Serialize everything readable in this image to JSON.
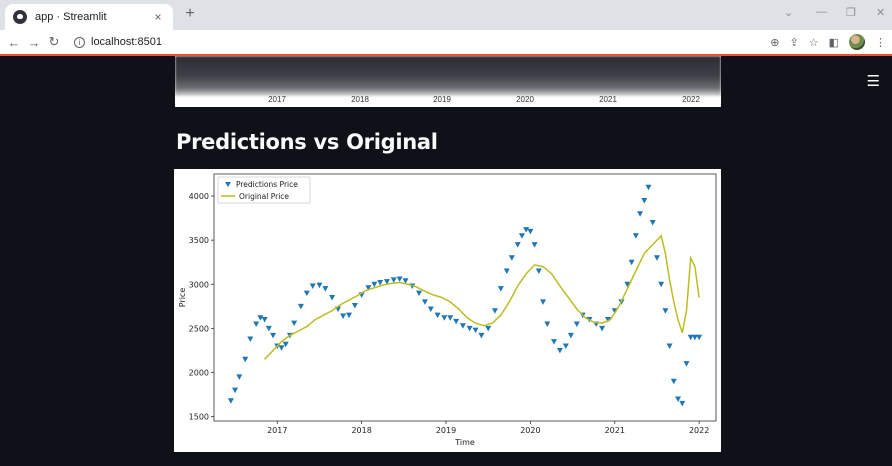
{
  "browser": {
    "tab_title": "app · Streamlit",
    "tab_close": "×",
    "new_tab": "+",
    "url": "localhost:8501",
    "win_minimize": "—",
    "win_restore": "❐",
    "win_close": "✕",
    "chevron": "⌄"
  },
  "app": {
    "menu_icon": "hamburger-menu-icon",
    "previous_chart_xticks": [
      "2017",
      "2018",
      "2019",
      "2020",
      "2021",
      "2022"
    ],
    "heading": "Predictions vs Original"
  },
  "chart_data": {
    "type": "line",
    "title": "",
    "xlabel": "Time",
    "ylabel": "Price",
    "xlim": [
      2016.25,
      2022.2
    ],
    "ylim": [
      1450,
      4250
    ],
    "xticks": [
      2017,
      2018,
      2019,
      2020,
      2021,
      2022
    ],
    "yticks": [
      1500,
      2000,
      2500,
      3000,
      3500,
      4000
    ],
    "legend_position": "top-left",
    "series": [
      {
        "name": "Predictions Price",
        "style": "triangle-down markers",
        "color": "#1f77b4",
        "x": [
          2016.45,
          2016.5,
          2016.55,
          2016.62,
          2016.68,
          2016.75,
          2016.8,
          2016.85,
          2016.9,
          2016.95,
          2017.0,
          2017.05,
          2017.1,
          2017.15,
          2017.2,
          2017.28,
          2017.35,
          2017.42,
          2017.5,
          2017.57,
          2017.65,
          2017.72,
          2017.78,
          2017.85,
          2017.92,
          2018.0,
          2018.08,
          2018.15,
          2018.22,
          2018.3,
          2018.38,
          2018.45,
          2018.52,
          2018.6,
          2018.68,
          2018.75,
          2018.82,
          2018.9,
          2018.98,
          2019.05,
          2019.12,
          2019.2,
          2019.28,
          2019.35,
          2019.42,
          2019.5,
          2019.58,
          2019.65,
          2019.72,
          2019.78,
          2019.85,
          2019.9,
          2019.95,
          2020.0,
          2020.05,
          2020.1,
          2020.15,
          2020.2,
          2020.28,
          2020.35,
          2020.42,
          2020.48,
          2020.55,
          2020.62,
          2020.7,
          2020.78,
          2020.85,
          2020.92,
          2021.0,
          2021.08,
          2021.15,
          2021.2,
          2021.25,
          2021.3,
          2021.35,
          2021.4,
          2021.45,
          2021.5,
          2021.55,
          2021.6,
          2021.65,
          2021.7,
          2021.75,
          2021.8,
          2021.85,
          2021.9,
          2021.95,
          2022.0
        ],
        "y": [
          1680,
          1800,
          1950,
          2150,
          2380,
          2550,
          2620,
          2600,
          2500,
          2420,
          2300,
          2280,
          2320,
          2420,
          2560,
          2750,
          2900,
          2980,
          2990,
          2950,
          2850,
          2720,
          2640,
          2650,
          2760,
          2880,
          2960,
          3000,
          3020,
          3030,
          3050,
          3060,
          3040,
          2980,
          2900,
          2800,
          2720,
          2650,
          2620,
          2620,
          2580,
          2530,
          2500,
          2480,
          2420,
          2500,
          2700,
          2950,
          3150,
          3300,
          3450,
          3550,
          3620,
          3600,
          3450,
          3150,
          2800,
          2550,
          2350,
          2250,
          2300,
          2420,
          2550,
          2650,
          2600,
          2550,
          2500,
          2600,
          2700,
          2800,
          3000,
          3250,
          3550,
          3800,
          3950,
          4100,
          3700,
          3300,
          3000,
          2700,
          2300,
          1900,
          1700,
          1650,
          2100,
          2400,
          2400,
          2400
        ]
      },
      {
        "name": "Original Price",
        "style": "line",
        "color": "#bcbd22",
        "x": [
          2016.85,
          2016.95,
          2017.05,
          2017.15,
          2017.25,
          2017.35,
          2017.45,
          2017.55,
          2017.65,
          2017.75,
          2017.85,
          2017.95,
          2018.05,
          2018.15,
          2018.25,
          2018.35,
          2018.45,
          2018.55,
          2018.65,
          2018.75,
          2018.85,
          2018.95,
          2019.05,
          2019.15,
          2019.25,
          2019.35,
          2019.45,
          2019.55,
          2019.65,
          2019.75,
          2019.85,
          2019.95,
          2020.05,
          2020.15,
          2020.25,
          2020.35,
          2020.45,
          2020.55,
          2020.65,
          2020.75,
          2020.85,
          2020.95,
          2021.05,
          2021.15,
          2021.25,
          2021.35,
          2021.45,
          2021.55,
          2021.6,
          2021.65,
          2021.7,
          2021.75,
          2021.8,
          2021.85,
          2021.9,
          2021.95,
          2022.0
        ],
        "y": [
          2150,
          2250,
          2350,
          2420,
          2470,
          2520,
          2600,
          2650,
          2700,
          2770,
          2820,
          2870,
          2930,
          2960,
          2990,
          3010,
          3020,
          3000,
          2970,
          2920,
          2880,
          2850,
          2800,
          2720,
          2620,
          2560,
          2530,
          2560,
          2650,
          2800,
          2980,
          3120,
          3220,
          3200,
          3120,
          2980,
          2850,
          2720,
          2620,
          2570,
          2560,
          2600,
          2750,
          2950,
          3150,
          3350,
          3450,
          3550,
          3350,
          3050,
          2800,
          2600,
          2450,
          2700,
          3300,
          3200,
          2850
        ]
      }
    ]
  }
}
